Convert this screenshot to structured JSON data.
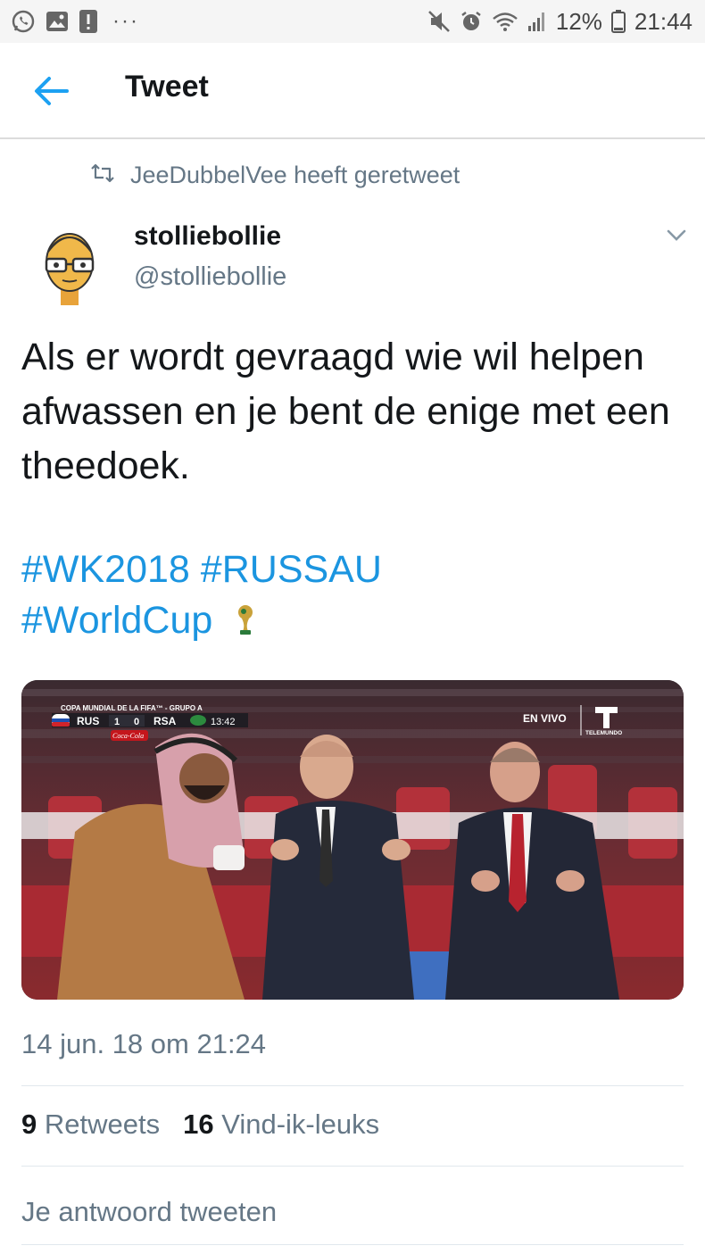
{
  "status_bar": {
    "battery": "12%",
    "time": "21:44",
    "dots": "···",
    "icons": [
      "whatsapp-icon",
      "gallery-icon",
      "alert-icon",
      "mute-icon",
      "alarm-icon",
      "wifi-icon",
      "signal-icon",
      "battery-icon"
    ]
  },
  "header": {
    "title": "Tweet",
    "back_icon": "back-arrow-icon"
  },
  "retweet": {
    "text": "JeeDubbelVee heeft geretweet",
    "icon": "retweet-icon"
  },
  "author": {
    "name": "stolliebollie",
    "handle": "@stolliebollie"
  },
  "tweet": {
    "text": "Als er wordt gevraagd wie wil helpen afwassen en je bent de enige met een theedoek.",
    "hashtags": [
      "#WK2018",
      "#RUSSAU",
      "#WorldCup"
    ]
  },
  "media": {
    "scorebug_title": "COPA MUNDIAL DE LA FIFA™ - GRUPO A",
    "team_home": "RUS",
    "score_home": "1",
    "score_away": "0",
    "team_away": "RSA",
    "clock": "13:42",
    "sponsor": "Coca-Cola",
    "live_label": "EN VIVO",
    "network": "TELEMUNDO"
  },
  "meta": {
    "timestamp": "14 jun. 18 om 21:24"
  },
  "stats": {
    "retweets_count": "9",
    "retweets_label": "Retweets",
    "likes_count": "16",
    "likes_label": "Vind-ik-leuks"
  },
  "reply": {
    "placeholder": "Je antwoord tweeten"
  },
  "colors": {
    "accent": "#1b95e0",
    "muted": "#657786",
    "text": "#14171a"
  }
}
